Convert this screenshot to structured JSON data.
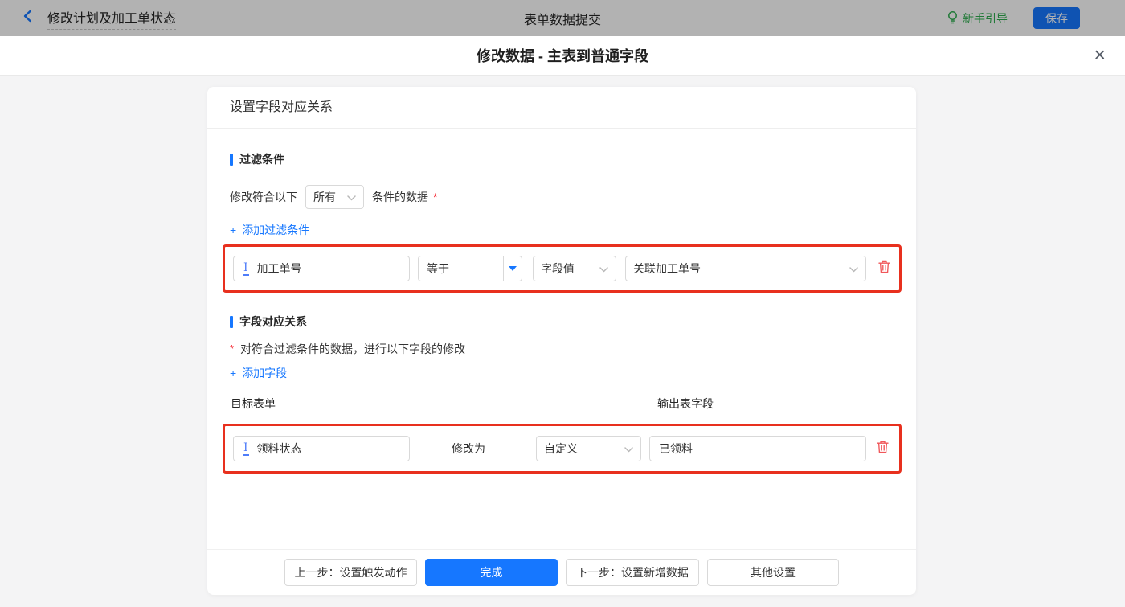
{
  "topbar": {
    "back_title": "修改计划及加工单状态",
    "center_title": "表单数据提交",
    "guide_label": "新手引导",
    "save_label": "保存"
  },
  "modal": {
    "title": "修改数据 - 主表到普通字段",
    "close_glyph": "×",
    "panel_title": "设置字段对应关系",
    "filter_section": {
      "title": "过滤条件",
      "line_prefix": "修改符合以下",
      "match_select_value": "所有",
      "line_suffix": "条件的数据",
      "required_mark": "*",
      "add_icon": "+",
      "add_label": "添加过滤条件",
      "row": {
        "field": "加工单号",
        "operator": "等于",
        "value_type": "字段值",
        "value": "关联加工单号"
      }
    },
    "mapping_section": {
      "title": "字段对应关系",
      "required_mark": "*",
      "description": "对符合过滤条件的数据，进行以下字段的修改",
      "add_icon": "+",
      "add_label": "添加字段",
      "col_target": "目标表单",
      "col_output": "输出表字段",
      "row": {
        "field": "领料状态",
        "middle_label": "修改为",
        "type_select": "自定义",
        "value": "已领料"
      }
    },
    "footer": {
      "prev_label": "上一步：设置触发动作",
      "done_label": "完成",
      "next_label": "下一步：设置新增数据",
      "other_label": "其他设置"
    }
  },
  "icons": {
    "back": "chevron-left",
    "guide": "lightbulb",
    "close": "x",
    "field_type": "single-line-text",
    "delete": "trash",
    "select_caret": "caret-down"
  },
  "colors": {
    "accent_blue": "#1677ff",
    "annotation_red": "#e8301e",
    "delete_red": "#f0575a",
    "required_red": "#f5222d",
    "guide_green": "#2fae4f",
    "body_gray": "#f4f4f5"
  }
}
